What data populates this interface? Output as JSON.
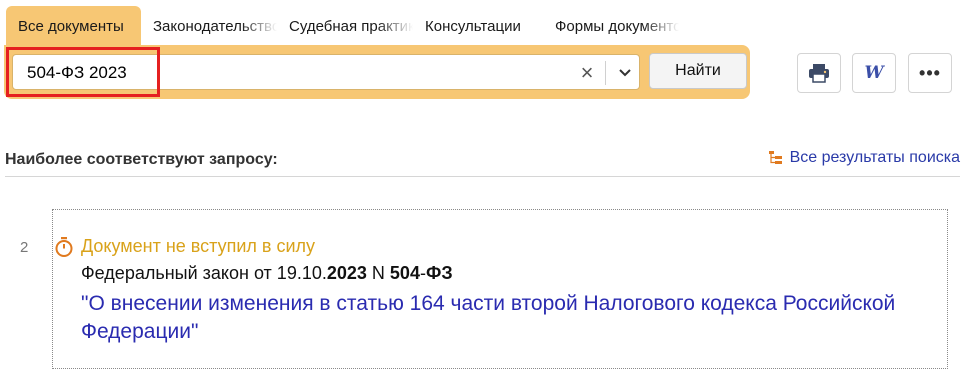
{
  "tabs": [
    {
      "label": "Все документы",
      "active": true
    },
    {
      "label": "Законодательство",
      "active": false
    },
    {
      "label": "Судебная практика",
      "active": false
    },
    {
      "label": "Консультации",
      "active": false
    },
    {
      "label": "Формы документов",
      "active": false
    }
  ],
  "search": {
    "value": "504-ФЗ 2023",
    "find_label": "Найти"
  },
  "toolbar": {
    "print_icon": "printer-icon",
    "word_icon": "word-export-icon",
    "word_glyph": "W",
    "more_icon": "more-icon",
    "more_glyph": "•••"
  },
  "results_header": {
    "title": "Наиболее соответствуют запросу:",
    "all_results_label": "Все результаты поиска"
  },
  "result": {
    "number": "2",
    "status": "Документ не вступил в силу",
    "doc_type": "Федеральный закон от 19.10.",
    "year": "2023",
    "n_prefix": " N ",
    "number_part": "504",
    "dash": "-",
    "suffix": "ФЗ",
    "title": "\"О внесении изменения в статью 164 части второй Налогового кодекса Российской Федерации\""
  },
  "colors": {
    "accent": "#f7c774",
    "highlight_border": "#e52020",
    "link": "#2a2bb0",
    "status": "#d9a21a"
  }
}
